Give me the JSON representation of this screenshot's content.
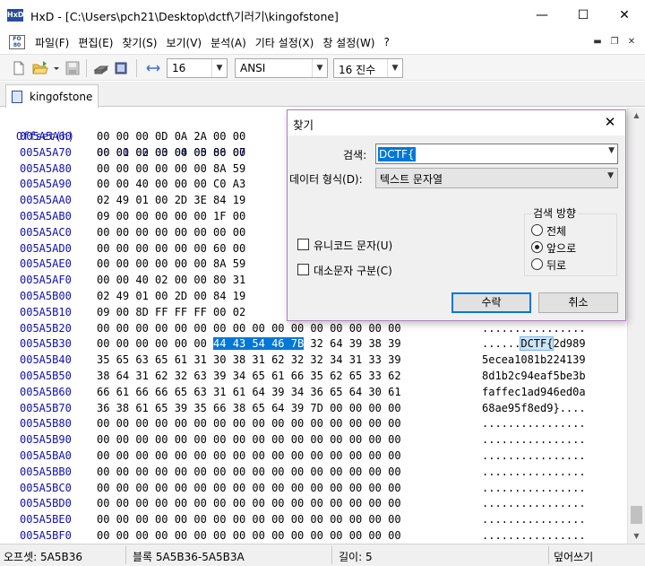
{
  "window": {
    "title": "HxD - [C:\\Users\\pch21\\Desktop\\dctf\\기러기\\kingofstone]",
    "app_icon_text": "HxD",
    "minimize": "—",
    "maximize": "☐",
    "close": "✕"
  },
  "menu": {
    "items": [
      "파일(F)",
      "편집(E)",
      "찾기(S)",
      "보기(V)",
      "분석(A)",
      "기타 설정(X)",
      "창 설정(W)",
      "?"
    ],
    "mdi_controls": [
      "▬",
      "❐",
      "✕"
    ]
  },
  "toolbar": {
    "bytes_per_row": "16",
    "charset": "ANSI",
    "offset_base": "16 진수"
  },
  "tab": {
    "name": "kingofstone"
  },
  "hex": {
    "header_offset": "Offset(h)",
    "header_columns": "00 01 02 03 04 05 06 07",
    "rows": [
      {
        "offset": "005A5A60",
        "bytes": "00 00 00 0D 0A 2A 00 00",
        "ascii": ""
      },
      {
        "offset": "005A5A70",
        "bytes": "00 00 00 00 00 00 80 00",
        "ascii": ""
      },
      {
        "offset": "005A5A80",
        "bytes": "00 00 00 00 00 00 8A 59",
        "ascii": ""
      },
      {
        "offset": "005A5A90",
        "bytes": "00 00 40 00 00 00 C0 A3",
        "ascii": ""
      },
      {
        "offset": "005A5AA0",
        "bytes": "02 49 01 00 2D 3E 84 19",
        "ascii": ""
      },
      {
        "offset": "005A5AB0",
        "bytes": "09 00 00 00 00 00 1F 00",
        "ascii": ""
      },
      {
        "offset": "005A5AC0",
        "bytes": "00 00 00 00 00 00 00 00",
        "ascii": ""
      },
      {
        "offset": "005A5AD0",
        "bytes": "00 00 00 00 00 00 60 00",
        "ascii": ""
      },
      {
        "offset": "005A5AE0",
        "bytes": "00 00 00 00 00 00 8A 59",
        "ascii": ""
      },
      {
        "offset": "005A5AF0",
        "bytes": "00 00 40 02 00 00 80 31",
        "ascii": ""
      },
      {
        "offset": "005A5B00",
        "bytes": "02 49 01 00 2D 00 84 19",
        "ascii": ""
      },
      {
        "offset": "005A5B10",
        "bytes": "09 00 8D FF FF FF 00 02",
        "ascii": ""
      },
      {
        "offset": "005A5B20",
        "bytes": "00 00 00 00 00 00 00 00 00 00 00 00 00 00 00 00",
        "ascii": "................"
      },
      {
        "offset": "005A5B30",
        "bytes": "00 00 00 00 00 00 ",
        "bytes_hl": "44 43 54 46 7B",
        "bytes_tail": " 32 64 39 38 39",
        "ascii": "......",
        "ascii_hl": "DCTF{",
        "ascii_tail": "2d989"
      },
      {
        "offset": "005A5B40",
        "bytes": "35 65 63 65 61 31 30 38 31 62 32 32 34 31 33 39",
        "ascii": "5ecea1081b224139"
      },
      {
        "offset": "005A5B50",
        "bytes": "38 64 31 62 32 63 39 34 65 61 66 35 62 65 33 62",
        "ascii": "8d1b2c94eaf5be3b"
      },
      {
        "offset": "005A5B60",
        "bytes": "66 61 66 66 65 63 31 61 64 39 34 36 65 64 30 61",
        "ascii": "faffec1ad946ed0a"
      },
      {
        "offset": "005A5B70",
        "bytes": "36 38 61 65 39 35 66 38 65 64 39 7D 00 00 00 00",
        "ascii": "68ae95f8ed9}...."
      },
      {
        "offset": "005A5B80",
        "bytes": "00 00 00 00 00 00 00 00 00 00 00 00 00 00 00 00",
        "ascii": "................"
      },
      {
        "offset": "005A5B90",
        "bytes": "00 00 00 00 00 00 00 00 00 00 00 00 00 00 00 00",
        "ascii": "................"
      },
      {
        "offset": "005A5BA0",
        "bytes": "00 00 00 00 00 00 00 00 00 00 00 00 00 00 00 00",
        "ascii": "................"
      },
      {
        "offset": "005A5BB0",
        "bytes": "00 00 00 00 00 00 00 00 00 00 00 00 00 00 00 00",
        "ascii": "................"
      },
      {
        "offset": "005A5BC0",
        "bytes": "00 00 00 00 00 00 00 00 00 00 00 00 00 00 00 00",
        "ascii": "................"
      },
      {
        "offset": "005A5BD0",
        "bytes": "00 00 00 00 00 00 00 00 00 00 00 00 00 00 00 00",
        "ascii": "................"
      },
      {
        "offset": "005A5BE0",
        "bytes": "00 00 00 00 00 00 00 00 00 00 00 00 00 00 00 00",
        "ascii": "................"
      },
      {
        "offset": "005A5BF0",
        "bytes": "00 00 00 00 00 00 00 00 00 00 00 00 00 00 00 00",
        "ascii": "................"
      }
    ]
  },
  "status": {
    "offset": "오프셋: 5A5B36",
    "block": "블록 5A5B36-5A5B3A",
    "length": "길이: 5",
    "mode": "덮어쓰기"
  },
  "find_dialog": {
    "title": "찾기",
    "search_label": "검색:",
    "search_value": "DCTF{",
    "datatype_label": "데이터 형식(D):",
    "datatype_value": "텍스트 문자열",
    "unicode_label": "유니코드 문자(U)",
    "case_label": "대소문자 구분(C)",
    "direction_title": "검색 방향",
    "dir_all": "전체",
    "dir_forward": "앞으로",
    "dir_backward": "뒤로",
    "selected_direction": "앞으로",
    "ok_label": "수락",
    "cancel_label": "취소"
  },
  "colors": {
    "offset_blue": "#1010b0",
    "selection_blue": "#0078d7",
    "dialog_border": "#b07ec0"
  }
}
